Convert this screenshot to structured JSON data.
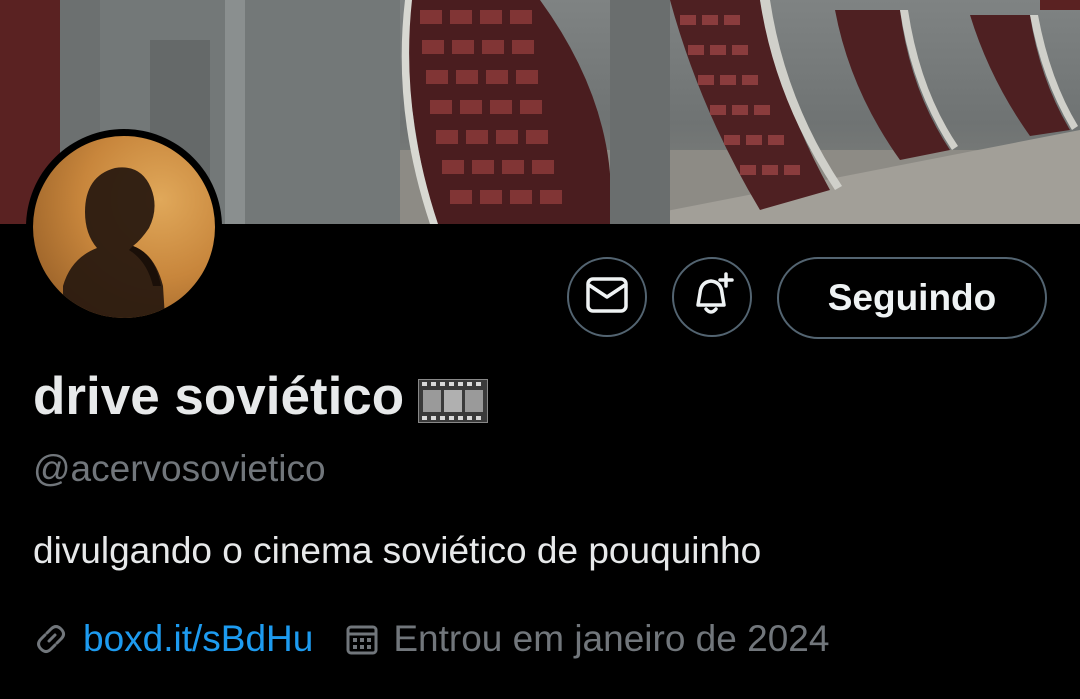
{
  "profile": {
    "display_name": "drive soviético",
    "name_emoji": "film-frames-emoji",
    "handle": "@acervosovietico",
    "bio": "divulgando o cinema soviético de pouquinho",
    "website": "boxd.it/sBdHu",
    "joined": "Entrou em janeiro de 2024"
  },
  "actions": {
    "message_icon": "envelope-icon",
    "notify_icon": "bell-plus-icon",
    "following_label": "Seguindo"
  },
  "icons": {
    "link": "link-icon",
    "calendar": "calendar-icon"
  },
  "colors": {
    "background": "#000000",
    "text_primary": "#e7e9ea",
    "text_secondary": "#71767b",
    "link": "#1d9bf0",
    "button_border": "#536471"
  }
}
